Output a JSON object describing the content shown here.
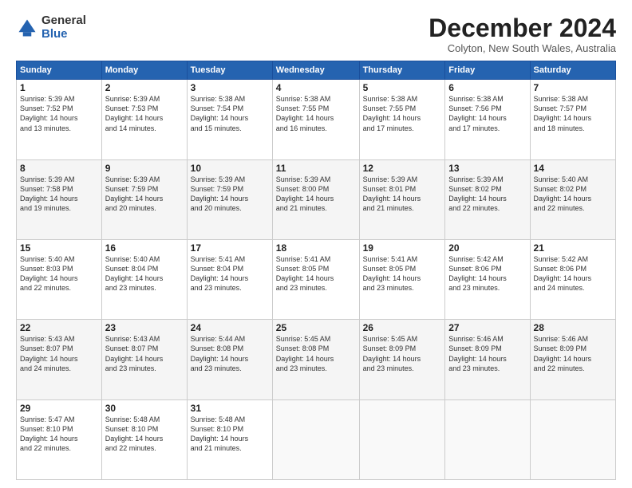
{
  "logo": {
    "general": "General",
    "blue": "Blue"
  },
  "title": "December 2024",
  "location": "Colyton, New South Wales, Australia",
  "days_of_week": [
    "Sunday",
    "Monday",
    "Tuesday",
    "Wednesday",
    "Thursday",
    "Friday",
    "Saturday"
  ],
  "weeks": [
    [
      {
        "day": "1",
        "info": "Sunrise: 5:39 AM\nSunset: 7:52 PM\nDaylight: 14 hours\nand 13 minutes."
      },
      {
        "day": "2",
        "info": "Sunrise: 5:39 AM\nSunset: 7:53 PM\nDaylight: 14 hours\nand 14 minutes."
      },
      {
        "day": "3",
        "info": "Sunrise: 5:38 AM\nSunset: 7:54 PM\nDaylight: 14 hours\nand 15 minutes."
      },
      {
        "day": "4",
        "info": "Sunrise: 5:38 AM\nSunset: 7:55 PM\nDaylight: 14 hours\nand 16 minutes."
      },
      {
        "day": "5",
        "info": "Sunrise: 5:38 AM\nSunset: 7:55 PM\nDaylight: 14 hours\nand 17 minutes."
      },
      {
        "day": "6",
        "info": "Sunrise: 5:38 AM\nSunset: 7:56 PM\nDaylight: 14 hours\nand 17 minutes."
      },
      {
        "day": "7",
        "info": "Sunrise: 5:38 AM\nSunset: 7:57 PM\nDaylight: 14 hours\nand 18 minutes."
      }
    ],
    [
      {
        "day": "8",
        "info": "Sunrise: 5:39 AM\nSunset: 7:58 PM\nDaylight: 14 hours\nand 19 minutes."
      },
      {
        "day": "9",
        "info": "Sunrise: 5:39 AM\nSunset: 7:59 PM\nDaylight: 14 hours\nand 20 minutes."
      },
      {
        "day": "10",
        "info": "Sunrise: 5:39 AM\nSunset: 7:59 PM\nDaylight: 14 hours\nand 20 minutes."
      },
      {
        "day": "11",
        "info": "Sunrise: 5:39 AM\nSunset: 8:00 PM\nDaylight: 14 hours\nand 21 minutes."
      },
      {
        "day": "12",
        "info": "Sunrise: 5:39 AM\nSunset: 8:01 PM\nDaylight: 14 hours\nand 21 minutes."
      },
      {
        "day": "13",
        "info": "Sunrise: 5:39 AM\nSunset: 8:02 PM\nDaylight: 14 hours\nand 22 minutes."
      },
      {
        "day": "14",
        "info": "Sunrise: 5:40 AM\nSunset: 8:02 PM\nDaylight: 14 hours\nand 22 minutes."
      }
    ],
    [
      {
        "day": "15",
        "info": "Sunrise: 5:40 AM\nSunset: 8:03 PM\nDaylight: 14 hours\nand 22 minutes."
      },
      {
        "day": "16",
        "info": "Sunrise: 5:40 AM\nSunset: 8:04 PM\nDaylight: 14 hours\nand 23 minutes."
      },
      {
        "day": "17",
        "info": "Sunrise: 5:41 AM\nSunset: 8:04 PM\nDaylight: 14 hours\nand 23 minutes."
      },
      {
        "day": "18",
        "info": "Sunrise: 5:41 AM\nSunset: 8:05 PM\nDaylight: 14 hours\nand 23 minutes."
      },
      {
        "day": "19",
        "info": "Sunrise: 5:41 AM\nSunset: 8:05 PM\nDaylight: 14 hours\nand 23 minutes."
      },
      {
        "day": "20",
        "info": "Sunrise: 5:42 AM\nSunset: 8:06 PM\nDaylight: 14 hours\nand 23 minutes."
      },
      {
        "day": "21",
        "info": "Sunrise: 5:42 AM\nSunset: 8:06 PM\nDaylight: 14 hours\nand 24 minutes."
      }
    ],
    [
      {
        "day": "22",
        "info": "Sunrise: 5:43 AM\nSunset: 8:07 PM\nDaylight: 14 hours\nand 24 minutes."
      },
      {
        "day": "23",
        "info": "Sunrise: 5:43 AM\nSunset: 8:07 PM\nDaylight: 14 hours\nand 23 minutes."
      },
      {
        "day": "24",
        "info": "Sunrise: 5:44 AM\nSunset: 8:08 PM\nDaylight: 14 hours\nand 23 minutes."
      },
      {
        "day": "25",
        "info": "Sunrise: 5:45 AM\nSunset: 8:08 PM\nDaylight: 14 hours\nand 23 minutes."
      },
      {
        "day": "26",
        "info": "Sunrise: 5:45 AM\nSunset: 8:09 PM\nDaylight: 14 hours\nand 23 minutes."
      },
      {
        "day": "27",
        "info": "Sunrise: 5:46 AM\nSunset: 8:09 PM\nDaylight: 14 hours\nand 23 minutes."
      },
      {
        "day": "28",
        "info": "Sunrise: 5:46 AM\nSunset: 8:09 PM\nDaylight: 14 hours\nand 22 minutes."
      }
    ],
    [
      {
        "day": "29",
        "info": "Sunrise: 5:47 AM\nSunset: 8:10 PM\nDaylight: 14 hours\nand 22 minutes."
      },
      {
        "day": "30",
        "info": "Sunrise: 5:48 AM\nSunset: 8:10 PM\nDaylight: 14 hours\nand 22 minutes."
      },
      {
        "day": "31",
        "info": "Sunrise: 5:48 AM\nSunset: 8:10 PM\nDaylight: 14 hours\nand 21 minutes."
      },
      {
        "day": "",
        "info": ""
      },
      {
        "day": "",
        "info": ""
      },
      {
        "day": "",
        "info": ""
      },
      {
        "day": "",
        "info": ""
      }
    ]
  ]
}
